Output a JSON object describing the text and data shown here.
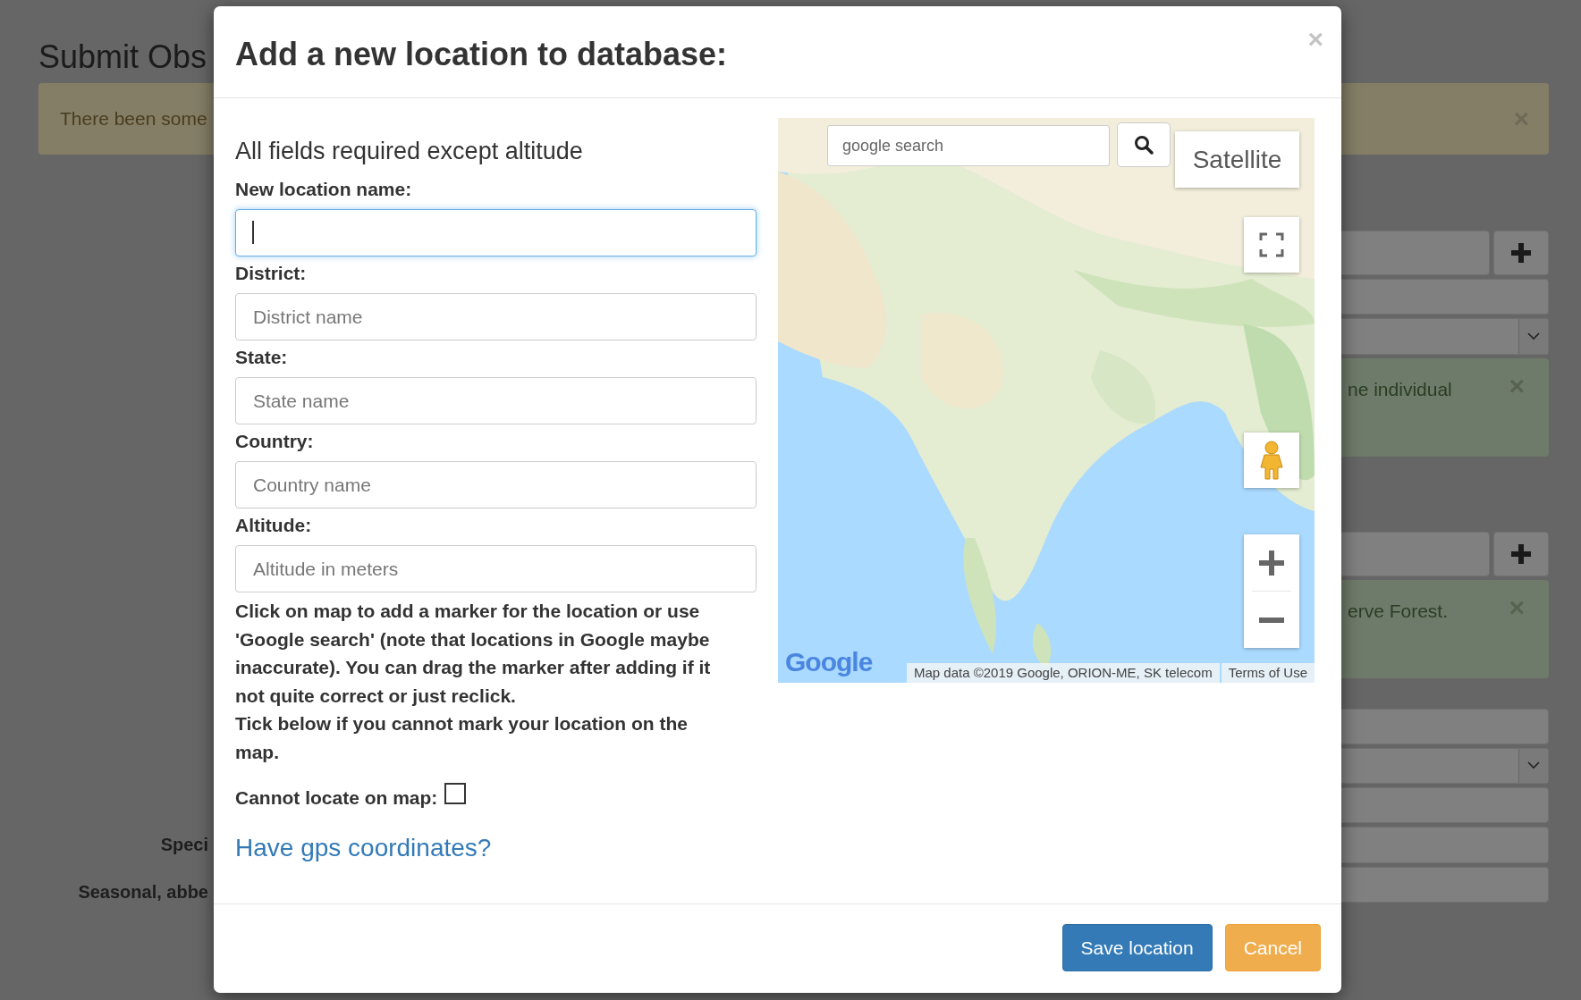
{
  "background": {
    "title": "Submit Obs",
    "warning_alert": {
      "text": "There been some",
      "close": "×"
    },
    "labels": [
      "Speci",
      "Seasonal, abbe"
    ],
    "rows": [
      {
        "kind": "input_add"
      },
      {
        "kind": "input"
      },
      {
        "kind": "select"
      },
      {
        "kind": "alert",
        "text": "ne individual",
        "close": "×"
      },
      {
        "kind": "input_add"
      },
      {
        "kind": "alert",
        "text": "erve Forest.",
        "close": "×"
      },
      {
        "kind": "input"
      },
      {
        "kind": "select"
      },
      {
        "kind": "input"
      },
      {
        "kind": "input"
      },
      {
        "kind": "textarea"
      }
    ]
  },
  "modal": {
    "title": "Add a new location to database:",
    "close": "×",
    "intro": "All fields required except altitude",
    "fields": [
      {
        "label": "New location name:",
        "focused": true
      },
      {
        "label": "District:",
        "placeholder": "District name",
        "focused": false
      },
      {
        "label": "State:",
        "placeholder": "State name",
        "focused": false
      },
      {
        "label": "Country:",
        "placeholder": "Country name",
        "focused": false
      },
      {
        "label": "Altitude:",
        "placeholder": "Altitude in meters",
        "focused": false
      }
    ],
    "instructions": "Click on map to add a marker for the location or use 'Google search' (note that locations in Google maybe inaccurate). You can drag the marker after adding if it not quite correct or just reclick.",
    "tick_note": "Tick below if you cannot mark your location on the map.",
    "cannot_locate": {
      "label": "Cannot locate on map:",
      "checked": false
    },
    "gps_link": "Have gps coordinates?",
    "map": {
      "search_placeholder": "google search",
      "map_type": "Satellite",
      "logo": "Google",
      "attribution": "Map data ©2019 Google, ORION-ME, SK telecom",
      "terms": "Terms of Use"
    },
    "buttons": [
      {
        "label": "Save location",
        "kind": "primary"
      },
      {
        "label": "Cancel",
        "kind": "warning"
      }
    ]
  }
}
